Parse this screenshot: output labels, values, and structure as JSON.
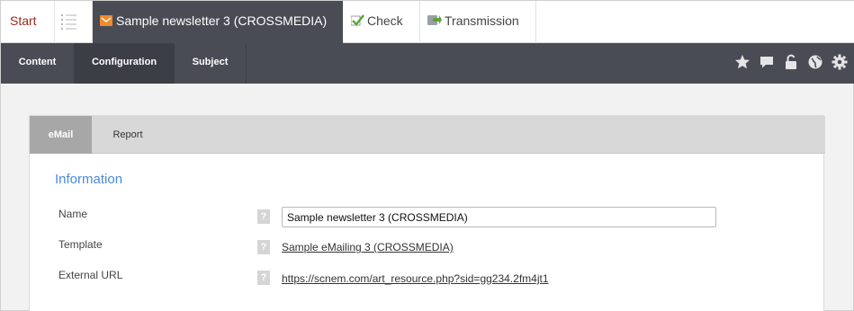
{
  "topbar": {
    "start_label": "Start",
    "list_icon": "list-icon",
    "active_tab_icon": "envelope-icon",
    "active_tab_label": "Sample newsletter 3 (CROSSMEDIA)",
    "check_label": "Check",
    "check_icon": "checkmark-icon",
    "transmission_label": "Transmission",
    "transmission_icon": "transmission-icon"
  },
  "nav": {
    "tabs": [
      {
        "label": "Content",
        "active": false
      },
      {
        "label": "Configuration",
        "active": true
      },
      {
        "label": "Subject",
        "active": false
      }
    ],
    "icons": [
      "star-icon",
      "comment-icon",
      "unlock-icon",
      "globe-icon",
      "gear-icon"
    ]
  },
  "subtabs": [
    {
      "label": "eMail",
      "active": true
    },
    {
      "label": "Report",
      "active": false
    }
  ],
  "form": {
    "section_title": "Information",
    "help_glyph": "?",
    "name_label": "Name",
    "name_value": "Sample newsletter 3 (CROSSMEDIA)",
    "template_label": "Template",
    "template_link": "Sample eMailing 3 (CROSSMEDIA)",
    "external_url_label": "External URL",
    "external_url_link": "https://scnem.com/art_resource.php?sid=gg234.2fm4jt1"
  },
  "colors": {
    "dark_nav": "#4a4c55",
    "start_text": "#9b2b1f",
    "section_title": "#4a8bd6",
    "active_subtab": "#a7a7a7"
  }
}
